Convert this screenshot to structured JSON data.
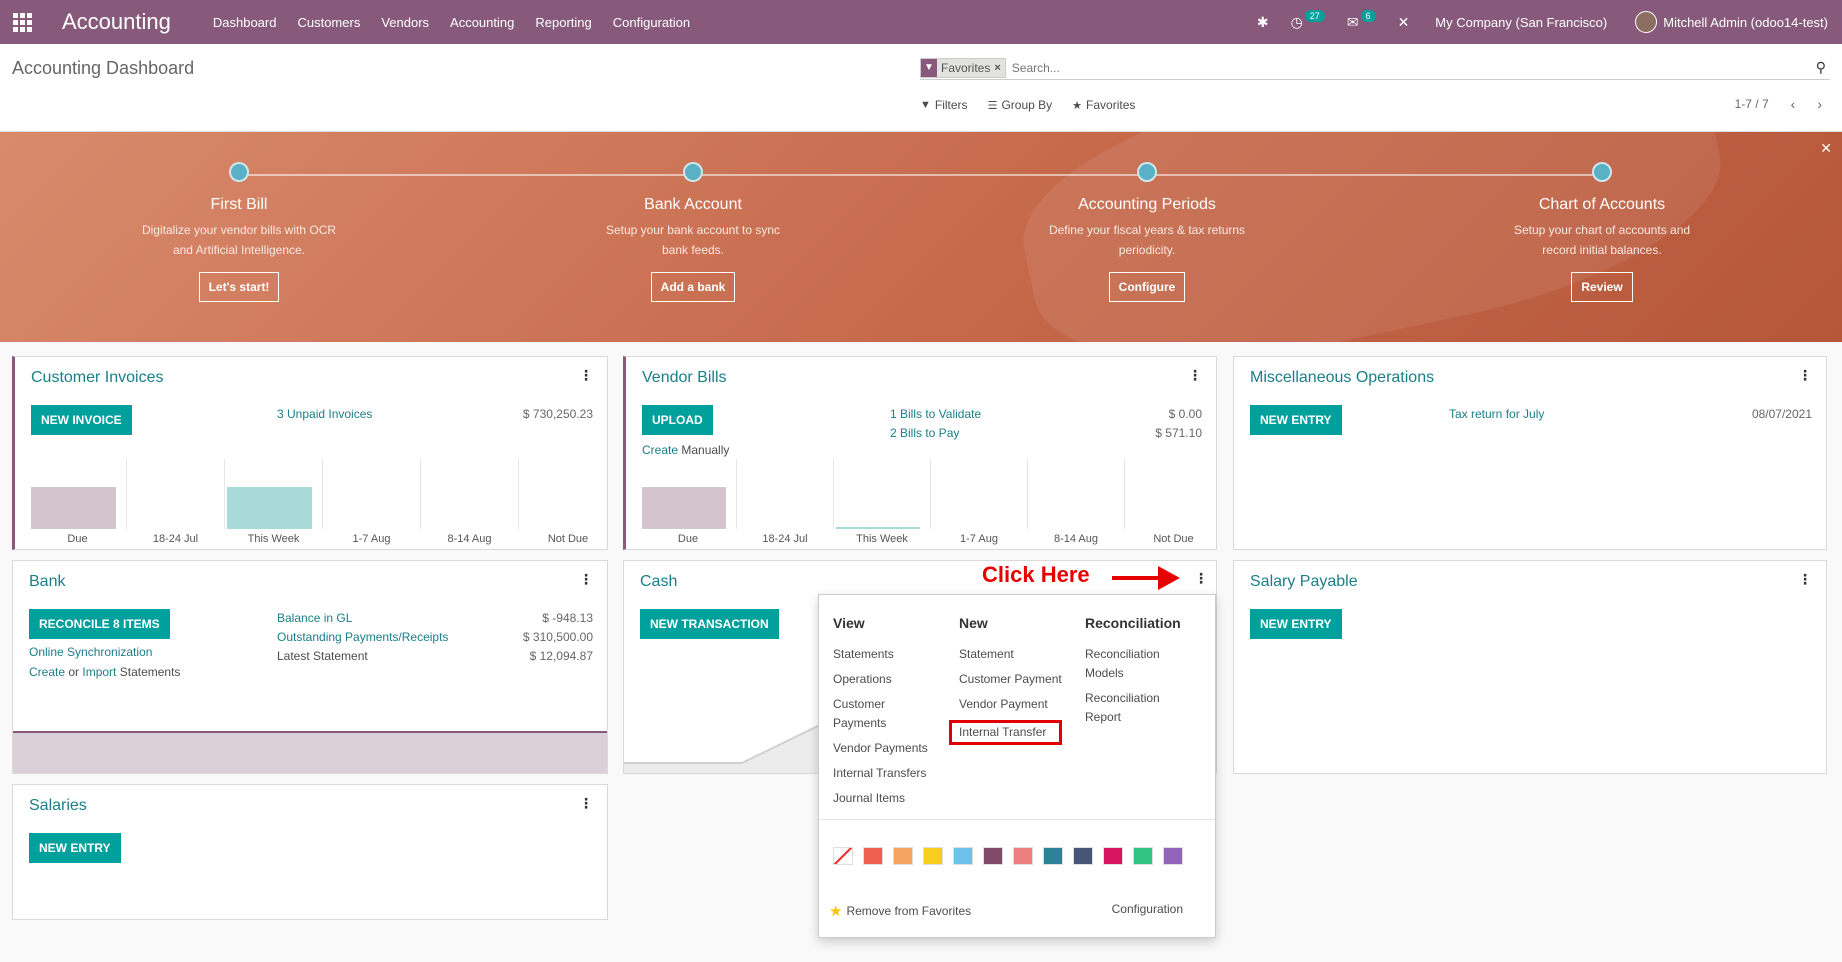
{
  "navbar": {
    "app_name": "Accounting",
    "menu": [
      "Dashboard",
      "Customers",
      "Vendors",
      "Accounting",
      "Reporting",
      "Configuration"
    ],
    "activity_count": "27",
    "message_count": "6",
    "company": "My Company (San Francisco)",
    "user": "Mitchell Admin (odoo14-test)"
  },
  "control_panel": {
    "title": "Accounting Dashboard",
    "facet_label": "Favorites",
    "search_placeholder": "Search...",
    "filters": "Filters",
    "group_by": "Group By",
    "favorites": "Favorites",
    "pager": "1-7 / 7"
  },
  "banner": {
    "steps": [
      {
        "title": "First Bill",
        "desc1": "Digitalize your vendor bills with OCR",
        "desc2": "and Artificial Intelligence.",
        "button": "Let's start!"
      },
      {
        "title": "Bank Account",
        "desc1": "Setup your bank account to sync",
        "desc2": "bank feeds.",
        "button": "Add a bank"
      },
      {
        "title": "Accounting Periods",
        "desc1": "Define your fiscal years & tax returns",
        "desc2": "periodicity.",
        "button": "Configure"
      },
      {
        "title": "Chart of Accounts",
        "desc1": "Setup your chart of accounts and",
        "desc2": "record initial balances.",
        "button": "Review"
      }
    ]
  },
  "cards": {
    "customer_invoices": {
      "title": "Customer Invoices",
      "button": "NEW INVOICE",
      "link": "3 Unpaid Invoices",
      "amount": "$ 730,250.23",
      "chart_labels": [
        "Due",
        "18-24 Jul",
        "This Week",
        "1-7 Aug",
        "8-14 Aug",
        "Not Due"
      ]
    },
    "vendor_bills": {
      "title": "Vendor Bills",
      "button": "UPLOAD",
      "create": "Create",
      "manually": " Manually",
      "link1": "1 Bills to Validate",
      "amount1": "$ 0.00",
      "link2": "2 Bills to Pay",
      "amount2": "$ 571.10",
      "chart_labels": [
        "Due",
        "18-24 Jul",
        "This Week",
        "1-7 Aug",
        "8-14 Aug",
        "Not Due"
      ]
    },
    "misc": {
      "title": "Miscellaneous Operations",
      "button": "NEW ENTRY",
      "link": "Tax return for July",
      "date": "08/07/2021"
    },
    "bank": {
      "title": "Bank",
      "button": "RECONCILE 8 ITEMS",
      "online_sync": "Online Synchronization",
      "create": "Create",
      "or": " or ",
      "import": "Import",
      "statements": " Statements",
      "balance_gl": "Balance in GL",
      "balance_gl_amount": "$ -948.13",
      "outstanding": "Outstanding Payments/Receipts",
      "outstanding_amount": "$ 310,500.00",
      "latest": "Latest Statement",
      "latest_amount": "$ 12,094.87"
    },
    "cash": {
      "title": "Cash",
      "button": "NEW TRANSACTION"
    },
    "salary_payable": {
      "title": "Salary Payable",
      "button": "NEW ENTRY"
    },
    "salaries": {
      "title": "Salaries",
      "button": "NEW ENTRY"
    }
  },
  "dropdown": {
    "view_header": "View",
    "view_items": [
      "Statements",
      "Operations",
      "Customer\nPayments",
      "Vendor Payments",
      "Internal Transfers",
      "Journal Items"
    ],
    "new_header": "New",
    "new_items": [
      "Statement",
      "Customer Payment",
      "Vendor Payment",
      "Internal Transfer"
    ],
    "reco_header": "Reconciliation",
    "reco_items": [
      "Reconciliation\nModels",
      "Reconciliation\nReport"
    ],
    "colors": [
      "#ffffff",
      "#f06050",
      "#f4a460",
      "#f7cd1f",
      "#6cc1ed",
      "#814968",
      "#eb7e7f",
      "#2c8397",
      "#475577",
      "#d6145f",
      "#30c381",
      "#9365b8"
    ],
    "remove_favorites": "Remove from Favorites",
    "configuration": "Configuration"
  },
  "annotation": {
    "click_here": "Click Here"
  }
}
